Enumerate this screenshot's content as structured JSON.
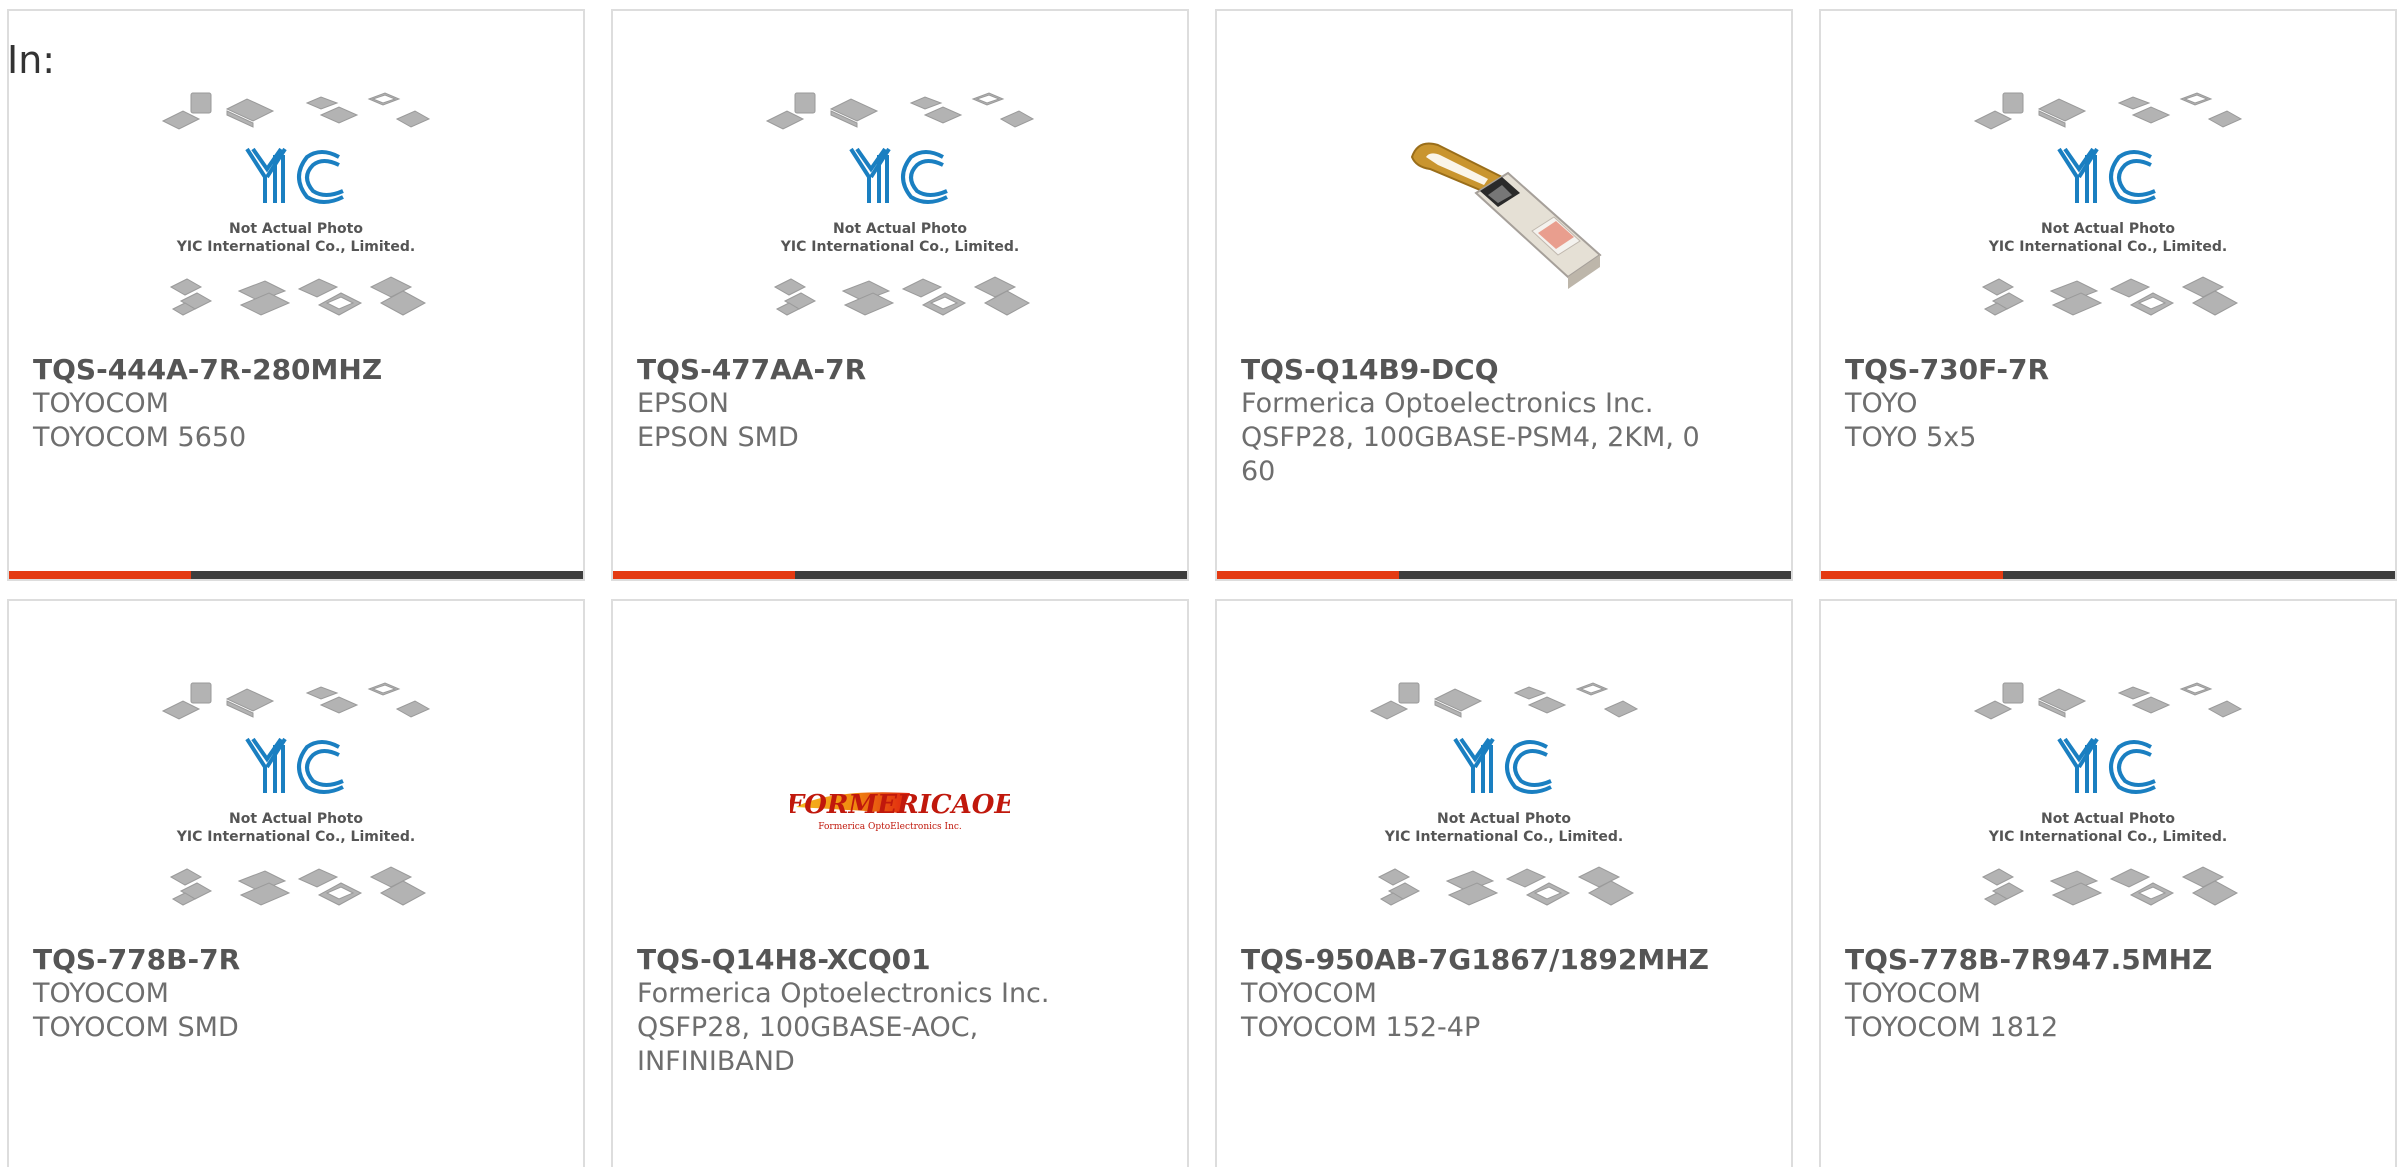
{
  "in_label": "In:",
  "placeholder": {
    "line1": "Not Actual Photo",
    "line2": "YIC International Co., Limited.",
    "logo_text": "YIC"
  },
  "formerica_logo": {
    "brand": "FORMERICAOE",
    "tagline": "Formerica OptoElectronics Inc."
  },
  "colors": {
    "accent": "#e43a12",
    "bar": "#3d3d3d",
    "border": "#dddddd",
    "part_text": "#555555",
    "sub_text": "#6e6e6e",
    "logo_blue": "#1a7fc1"
  },
  "products": [
    {
      "part": "TQS-444A-7R-280MHZ",
      "manufacturer": "TOYOCOM",
      "description": "TOYOCOM 5650",
      "image": "placeholder"
    },
    {
      "part": "TQS-477AA-7R",
      "manufacturer": "EPSON",
      "description": "EPSON SMD",
      "image": "placeholder"
    },
    {
      "part": "TQS-Q14B9-DCQ",
      "manufacturer": "Formerica Optoelectronics Inc.",
      "description": "QSFP28, 100GBASE-PSM4, 2KM, 0\n60",
      "image": "transceiver-photo"
    },
    {
      "part": "TQS-730F-7R",
      "manufacturer": "TOYO",
      "description": "TOYO 5x5",
      "image": "placeholder"
    },
    {
      "part": "TQS-778B-7R",
      "manufacturer": "TOYOCOM",
      "description": "TOYOCOM SMD",
      "image": "placeholder"
    },
    {
      "part": "TQS-Q14H8-XCQ01",
      "manufacturer": "Formerica Optoelectronics Inc.",
      "description": "QSFP28, 100GBASE-AOC,\nINFINIBAND",
      "image": "formerica-logo"
    },
    {
      "part": "TQS-950AB-7G1867/1892MHZ",
      "manufacturer": "TOYOCOM",
      "description": "TOYOCOM 152-4P",
      "image": "placeholder"
    },
    {
      "part": "TQS-778B-7R947.5MHZ",
      "manufacturer": "TOYOCOM",
      "description": "TOYOCOM 1812",
      "image": "placeholder"
    }
  ]
}
